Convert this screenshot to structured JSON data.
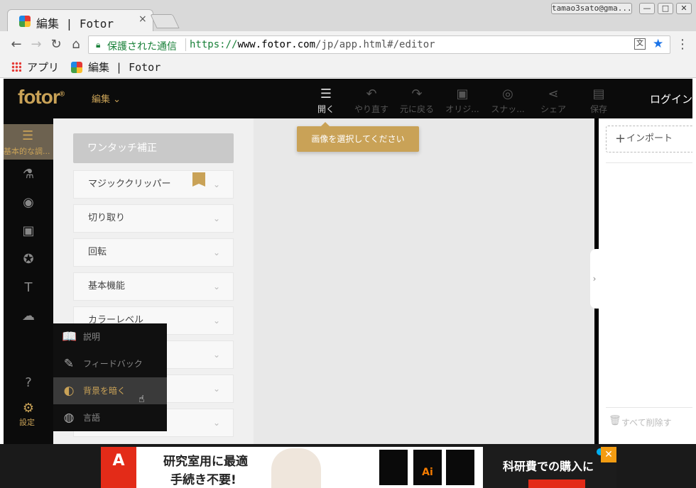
{
  "browser": {
    "tab_title": "編集 | Fotor",
    "tab_close": "×",
    "user": "tamao3sato@gma...",
    "window_buttons": [
      "—",
      "□",
      "✕"
    ],
    "nav": {
      "back": "←",
      "forward": "→",
      "reload": "↻",
      "home": "⌂"
    },
    "secure_label": "保護された通信",
    "url_scheme": "https://",
    "url_host": "www.fotor.com",
    "url_path": "/jp/app.html#/editor",
    "translate_icon": "文",
    "menu": "⋮",
    "bookmarks": {
      "apps_label": "アプリ",
      "fotor_label": "編集 | Fotor"
    }
  },
  "app": {
    "logo": "fotor",
    "logo_reg": "®",
    "edit_menu": "編集 ⌄",
    "toolbar": [
      {
        "icon": "☰",
        "label": "開く",
        "active": true
      },
      {
        "icon": "↶",
        "label": "やり直す"
      },
      {
        "icon": "↷",
        "label": "元に戻る"
      },
      {
        "icon": "▣",
        "label": "オリジ..."
      },
      {
        "icon": "◎",
        "label": "スナッ..."
      },
      {
        "icon": "⋖",
        "label": "シェア"
      },
      {
        "icon": "▤",
        "label": "保存"
      }
    ],
    "login": "ログイン",
    "leftnav": {
      "basic_label": "基本的な調...",
      "icons": [
        "⚗",
        "◉",
        "▣",
        "✪",
        "T",
        "☁",
        "?",
        "⚙"
      ],
      "settings_label": "設定"
    },
    "panel": {
      "one_touch": "ワンタッチ補正",
      "items": [
        "マジッククリッパー",
        "切り取り",
        "回転",
        "基本機能",
        "カラーレベル",
        "",
        "",
        ""
      ],
      "chevron": "⌄"
    },
    "tooltip": "画像を選択してください",
    "collapse": "›",
    "right": {
      "import_plus": "+",
      "import_label": "インポート",
      "delete_all": "すべて削除す",
      "trash": "🗑"
    },
    "popup": [
      {
        "icon": "📖",
        "label": "説明"
      },
      {
        "icon": "✎",
        "label": "フィードバック"
      },
      {
        "icon": "◐",
        "label": "背景を暗く",
        "selected": true
      },
      {
        "icon": "◍",
        "label": "言語"
      }
    ]
  },
  "ad": {
    "adobe": "A",
    "line1": "研究室用に最適",
    "line2": "手続き不要!",
    "box_ai": "Ai",
    "cta": "科研費での購入に",
    "close": "✕"
  }
}
